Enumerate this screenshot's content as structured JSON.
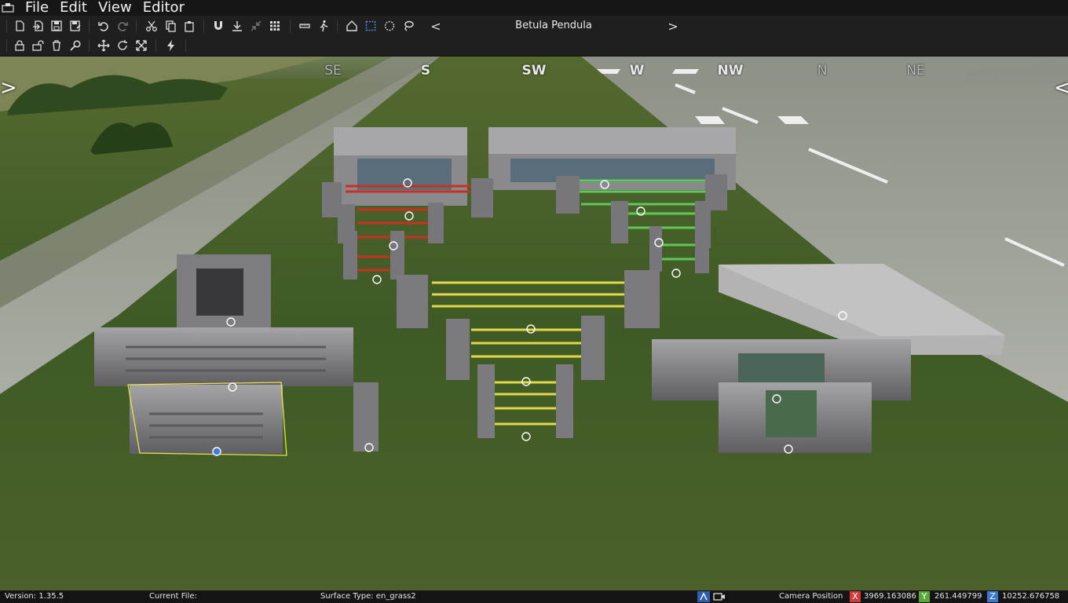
{
  "menu": {
    "items": [
      "File",
      "Edit",
      "View",
      "Editor"
    ]
  },
  "toolbar": {
    "row1_icons": [
      "new-file-icon",
      "import-icon",
      "save-icon",
      "save-as-icon",
      "undo-icon",
      "redo-icon",
      "cut-icon",
      "copy-icon",
      "paste-icon",
      "magnet-icon",
      "drop-to-ground-icon",
      "collapse-icon",
      "grid-icon",
      "measure-icon",
      "walk-icon",
      "home-icon",
      "box-select-icon",
      "circle-select-icon",
      "lasso-select-icon"
    ],
    "row2_icons": [
      "lock-icon",
      "unlock-icon",
      "delete-icon",
      "search-icon",
      "move-icon",
      "rotate-icon",
      "scale-icon",
      "lightning-icon"
    ],
    "brush": {
      "prev_label": "<",
      "name": "Betula Pendula",
      "next_label": ">"
    }
  },
  "viewport": {
    "compass": [
      {
        "label": "SE",
        "dim": true
      },
      {
        "label": "S",
        "dim": false
      },
      {
        "label": "SW",
        "dim": false
      },
      {
        "label": "W",
        "dim": false
      },
      {
        "label": "NW",
        "dim": false
      },
      {
        "label": "N",
        "dim": true
      },
      {
        "label": "NE",
        "dim": true
      }
    ],
    "left_toggle": ">",
    "right_toggle": "<"
  },
  "status": {
    "version": "Version: 1.35.5",
    "current_file": "Current File:",
    "surface_type": "Surface Type: en_grass2",
    "camera_label": "Camera Position",
    "x_label": "X",
    "x_value": "3969.163086",
    "y_label": "Y",
    "y_value": "261.449799",
    "z_label": "Z",
    "z_value": "10252.676758",
    "colors": {
      "x": "#d23b3b",
      "y": "#5aa83a",
      "z": "#3b78d2"
    }
  }
}
